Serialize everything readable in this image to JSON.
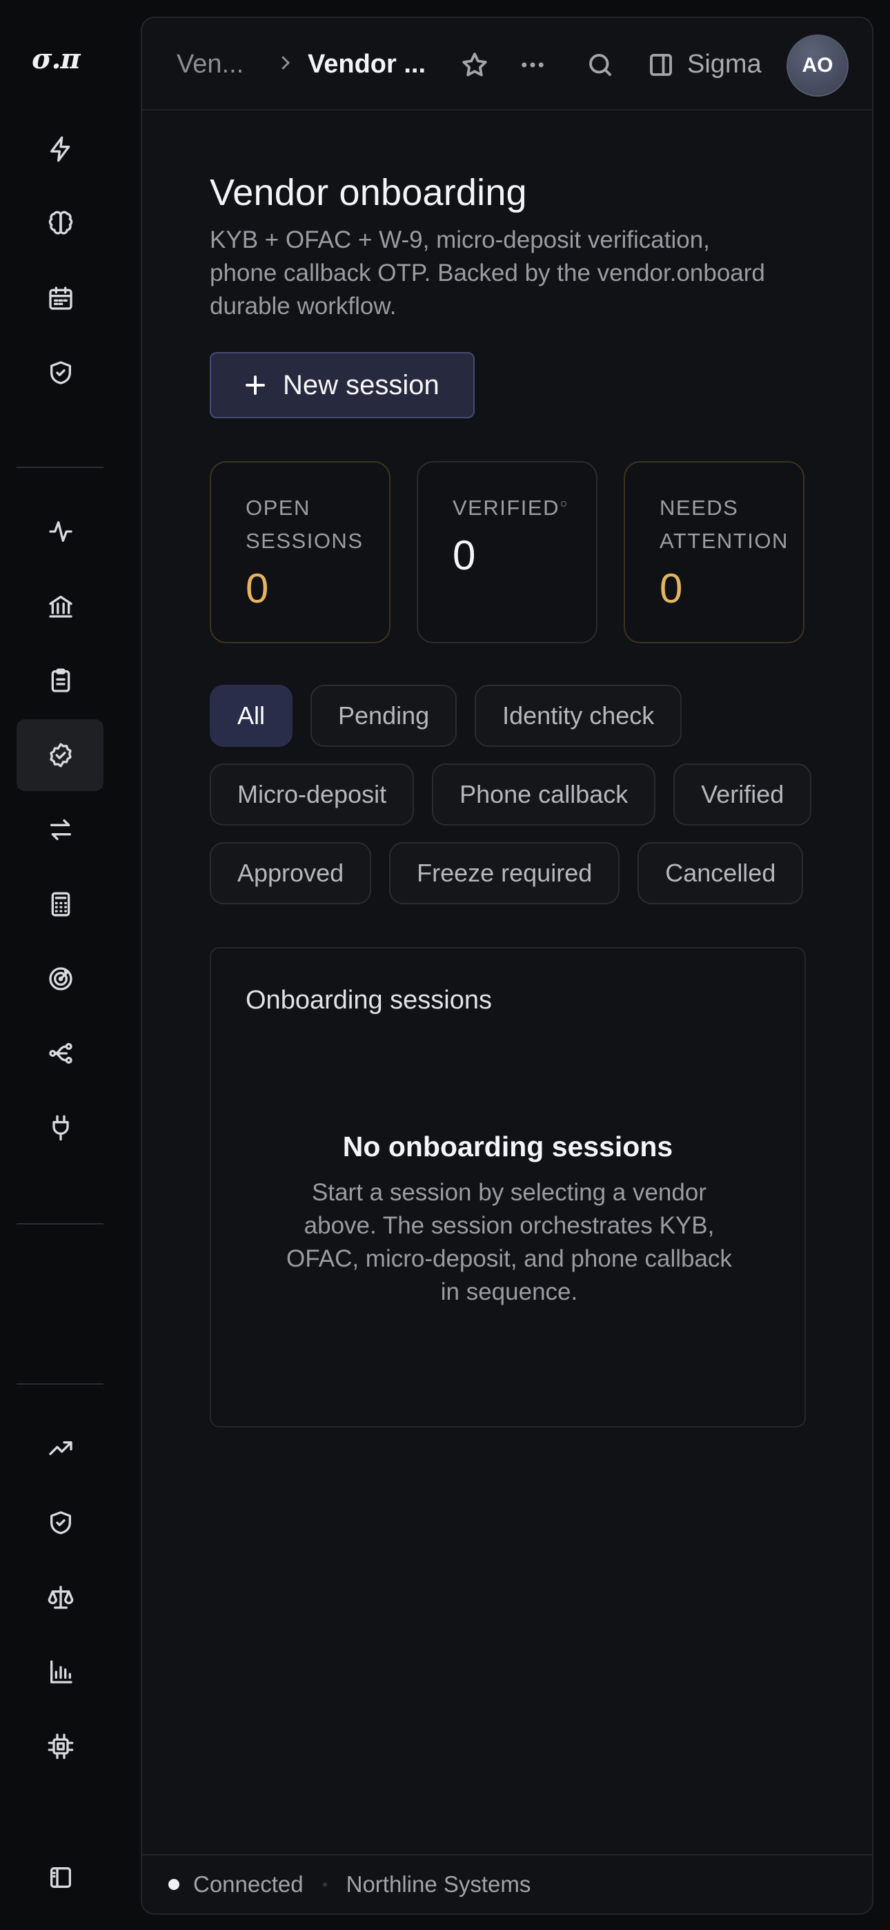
{
  "app": {
    "logo": "σ.π",
    "rail_icons_top": [
      "bolt-icon",
      "brain-icon",
      "calendar-icon",
      "shield-check-icon"
    ],
    "rail_icons_mid": [
      "activity-icon",
      "bank-icon",
      "clipboard-icon",
      "badge-check-icon",
      "transfer-icon",
      "calculator-icon",
      "target-icon",
      "workflow-icon",
      "plug-icon"
    ],
    "rail_icons_bottom": [
      "trending-up-icon",
      "shield-check-icon",
      "scale-icon",
      "bar-chart-icon",
      "chip-icon"
    ],
    "rail_footer_icon": "sidebar-toggle-icon",
    "active_rail_item": "badge-check-icon"
  },
  "topbar": {
    "breadcrumb_parent": "Ven...",
    "breadcrumb_current": "Vendor ...",
    "workspace": "Sigma",
    "avatar_initials": "AO"
  },
  "page": {
    "title": "Vendor onboarding",
    "subtitle": "KYB + OFAC + W-9, micro-deposit verification, phone callback OTP. Backed by the vendor.onboard durable workflow.",
    "new_button_label": "New session"
  },
  "stats": [
    {
      "label": "Open sessions",
      "value": "0"
    },
    {
      "label": "Verified",
      "value": "0"
    },
    {
      "label": "Needs attention",
      "value": "0"
    }
  ],
  "filters": {
    "selected": "All",
    "options": [
      "All",
      "Pending",
      "Identity check",
      "Micro-deposit",
      "Phone callback",
      "Verified",
      "Approved",
      "Freeze required",
      "Cancelled"
    ]
  },
  "sessions": {
    "title": "Onboarding sessions",
    "empty_title": "No onboarding sessions",
    "empty_text": "Start a session by selecting a vendor above. The session orchestrates KYB, OFAC, micro-deposit, and phone callback in sequence."
  },
  "footer": {
    "status": "Connected",
    "org": "Northline Systems"
  },
  "colors": {
    "accent": "#2a2d4a",
    "warning_value": "#e4b55e",
    "background": "#0b0c0e",
    "panel": "#111215"
  }
}
